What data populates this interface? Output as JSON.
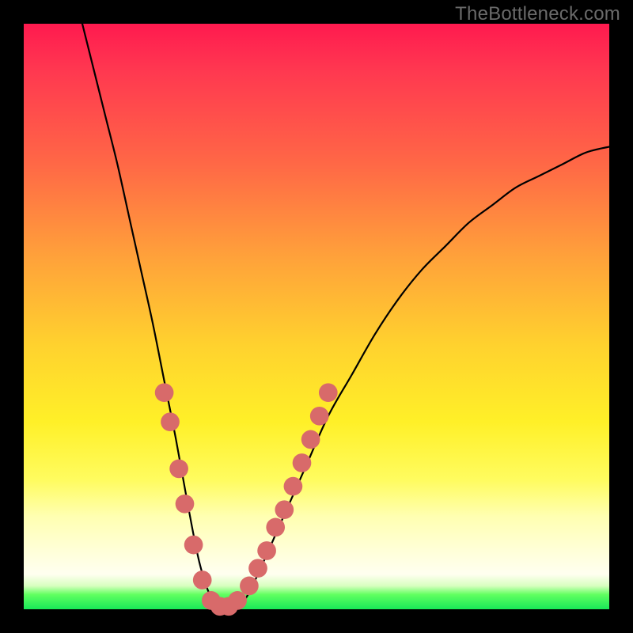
{
  "watermark": "TheBottleneck.com",
  "chart_data": {
    "type": "line",
    "title": "",
    "xlabel": "",
    "ylabel": "",
    "xlim": [
      0,
      100
    ],
    "ylim": [
      0,
      100
    ],
    "series": [
      {
        "name": "bottleneck-curve",
        "x": [
          10,
          12,
          14,
          16,
          18,
          20,
          22,
          24,
          26,
          28,
          30,
          32,
          34,
          36,
          38,
          40,
          44,
          48,
          52,
          56,
          60,
          64,
          68,
          72,
          76,
          80,
          84,
          88,
          92,
          96,
          100
        ],
        "values": [
          100,
          92,
          84,
          76,
          67,
          58,
          49,
          39,
          29,
          18,
          8,
          2,
          0,
          0,
          2,
          6,
          15,
          24,
          33,
          40,
          47,
          53,
          58,
          62,
          66,
          69,
          72,
          74,
          76,
          78,
          79
        ]
      }
    ],
    "dots": {
      "name": "marker-dots",
      "color": "#d86a6a",
      "radius_pct": 1.6,
      "points": [
        {
          "x": 24.0,
          "y": 37
        },
        {
          "x": 25.0,
          "y": 32
        },
        {
          "x": 26.5,
          "y": 24
        },
        {
          "x": 27.5,
          "y": 18
        },
        {
          "x": 29.0,
          "y": 11
        },
        {
          "x": 30.5,
          "y": 5
        },
        {
          "x": 32.0,
          "y": 1.5
        },
        {
          "x": 33.5,
          "y": 0.5
        },
        {
          "x": 35.0,
          "y": 0.5
        },
        {
          "x": 36.5,
          "y": 1.5
        },
        {
          "x": 38.5,
          "y": 4
        },
        {
          "x": 40.0,
          "y": 7
        },
        {
          "x": 41.5,
          "y": 10
        },
        {
          "x": 43.0,
          "y": 14
        },
        {
          "x": 44.5,
          "y": 17
        },
        {
          "x": 46.0,
          "y": 21
        },
        {
          "x": 47.5,
          "y": 25
        },
        {
          "x": 49.0,
          "y": 29
        },
        {
          "x": 50.5,
          "y": 33
        },
        {
          "x": 52.0,
          "y": 37
        }
      ]
    }
  }
}
